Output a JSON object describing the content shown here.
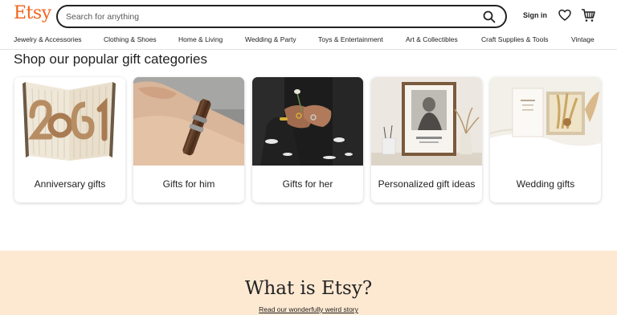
{
  "header": {
    "logo": "Etsy",
    "search_placeholder": "Search for anything",
    "signin_label": "Sign in"
  },
  "nav": {
    "items": [
      "Jewelry & Accessories",
      "Clothing & Shoes",
      "Home & Living",
      "Wedding & Party",
      "Toys & Entertainment",
      "Art & Collectibles",
      "Craft Supplies & Tools",
      "Vintage"
    ]
  },
  "gifts": {
    "title": "Shop our popular gift categories",
    "cards": [
      {
        "label": "Anniversary gifts"
      },
      {
        "label": "Gifts for him"
      },
      {
        "label": "Gifts for her"
      },
      {
        "label": "Personalized gift ideas"
      },
      {
        "label": "Wedding gifts"
      }
    ]
  },
  "about": {
    "title": "What is Etsy?",
    "link": "Read our wonderfully weird story"
  },
  "colors": {
    "brand": "#f1641e",
    "about_bg": "#fde9d2",
    "text": "#222222"
  }
}
